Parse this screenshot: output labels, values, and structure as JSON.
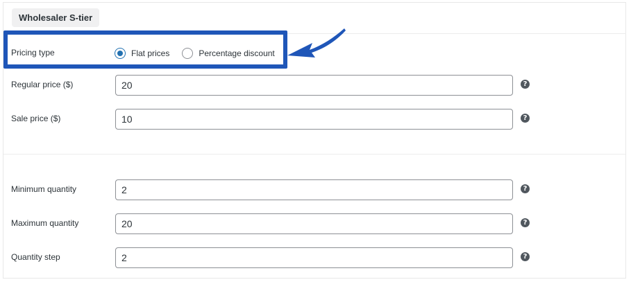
{
  "tier": {
    "name": "Wholesaler S-tier"
  },
  "pricing_type": {
    "label": "Pricing type",
    "selected": "flat",
    "options": [
      {
        "id": "flat",
        "label": "Flat prices"
      },
      {
        "id": "percentage",
        "label": "Percentage discount"
      }
    ]
  },
  "fields": {
    "regular_price": {
      "label": "Regular price ($)",
      "value": "20"
    },
    "sale_price": {
      "label": "Sale price ($)",
      "value": "10"
    },
    "minimum_quantity": {
      "label": "Minimum quantity",
      "value": "2"
    },
    "maximum_quantity": {
      "label": "Maximum quantity",
      "value": "20"
    },
    "quantity_step": {
      "label": "Quantity step",
      "value": "2"
    }
  },
  "help_icon": {
    "glyph": "?",
    "icon": "question-circle-icon"
  },
  "colors": {
    "highlight": "#1f56b8",
    "radio_accent": "#2271b1"
  }
}
